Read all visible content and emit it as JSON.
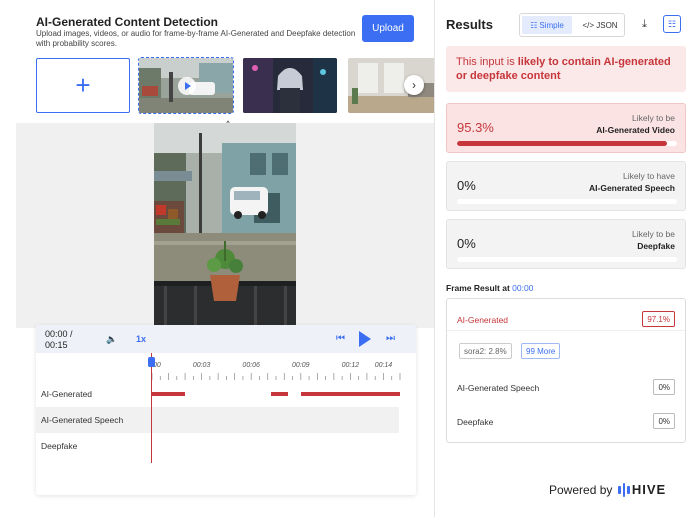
{
  "header": {
    "title": "AI-Generated Content Detection",
    "description": "Upload images, videos, or audio for frame-by-frame AI-Generated and Deepfake detection with probability scores.",
    "upload_label": "Upload"
  },
  "gallery": {
    "add_symbol": "+",
    "next_symbol": "›",
    "items": [
      {
        "name": "flooded-street-video",
        "selected": true
      },
      {
        "name": "cyber-woman-image",
        "selected": false
      },
      {
        "name": "interior-room-image",
        "selected": false
      }
    ]
  },
  "viewer": {
    "collapse_symbol": "^"
  },
  "player": {
    "current_time": "00:00 /",
    "duration": "00:15",
    "speed": "1x",
    "volume_icon": "🔈",
    "skip_back_icon": "⏮",
    "skip_fwd_icon": "⏭",
    "ticks": [
      "00:00",
      "00:03",
      "00:06",
      "00:09",
      "00:12",
      "00:14"
    ],
    "tracks": [
      {
        "label": "AI-Generated",
        "segments": [
          [
            0,
            2.0
          ],
          [
            7.2,
            8.2
          ],
          [
            9.0,
            15.0
          ]
        ]
      },
      {
        "label": "AI-Generated Speech",
        "segments": []
      },
      {
        "label": "Deepfake",
        "segments": []
      }
    ],
    "duration_seconds": 15
  },
  "results": {
    "title": "Results",
    "toggle_simple": "Simple",
    "toggle_json": "</> JSON",
    "download_icon": "⤓",
    "verdict_lead": "This input is ",
    "verdict_strong": "likely to contain AI-generated or deepfake content",
    "cards": [
      {
        "value": "95.3%",
        "line1": "Likely to be",
        "line2": "AI-Generated Video",
        "fill": 0.953,
        "highlight": true
      },
      {
        "value": "0%",
        "line1": "Likely to have",
        "line2": "AI-Generated Speech",
        "fill": 0,
        "highlight": false
      },
      {
        "value": "0%",
        "line1": "Likely to be",
        "line2": "Deepfake",
        "fill": 0,
        "highlight": false
      }
    ],
    "frame_label": "Frame Result at ",
    "frame_time": "00:00",
    "frame_rows": [
      {
        "label": "AI-Generated",
        "value": "97.1%"
      },
      {
        "label": "AI-Generated Speech",
        "value": "0%"
      },
      {
        "label": "Deepfake",
        "value": "0%"
      }
    ],
    "frame_tag_model": "sora2: 2.8%",
    "frame_tag_more": "99 More",
    "powered_by": "Powered by",
    "brand": "HIVE"
  },
  "colors": {
    "accent": "#3b6ef2",
    "alert": "#c6363b"
  }
}
